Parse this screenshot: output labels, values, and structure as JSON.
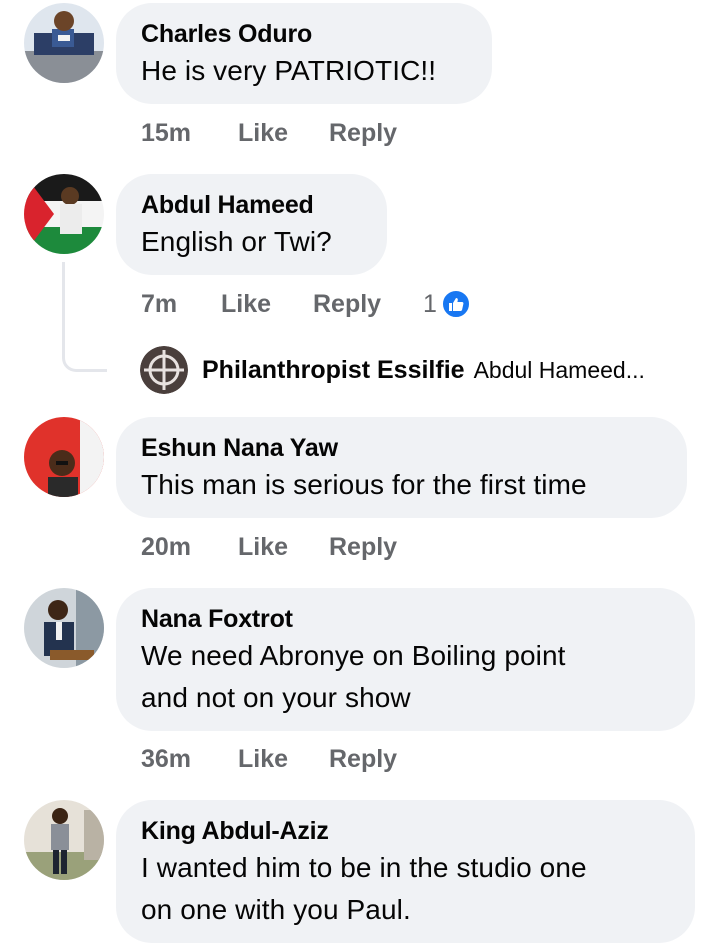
{
  "comments": [
    {
      "author": "Charles Oduro",
      "lines": [
        "He is very PATRIOTIC!!"
      ],
      "time": "15m",
      "like_label": "Like",
      "reply_label": "Reply",
      "avatar": "child-photo-avatar"
    },
    {
      "author": "Abdul Hameed",
      "lines": [
        "English or Twi?"
      ],
      "time": "7m",
      "like_label": "Like",
      "reply_label": "Reply",
      "reaction_count": "1",
      "reaction_icon": "thumbs-up-icon",
      "avatar": "flag-photo-avatar",
      "reply_preview": {
        "author": "Philanthropist Essilfie",
        "snippet": "Abdul Hameed..."
      }
    },
    {
      "author": "Eshun Nana Yaw",
      "lines": [
        "This man is serious for the first time"
      ],
      "time": "20m",
      "like_label": "Like",
      "reply_label": "Reply",
      "avatar": "man-red-background-avatar"
    },
    {
      "author": "Nana Foxtrot",
      "lines": [
        "We need Abronye on Boiling point",
        "and not on your show"
      ],
      "time": "36m",
      "like_label": "Like",
      "reply_label": "Reply",
      "avatar": "man-at-podium-avatar"
    },
    {
      "author": "King Abdul-Aziz",
      "lines": [
        "I wanted him to be in the studio one",
        "on one with you Paul."
      ],
      "avatar": "man-standing-avatar"
    }
  ],
  "colors": {
    "bubble": "#f0f2f5",
    "meta_text": "#65676b",
    "like_blue": "#1877f2"
  }
}
